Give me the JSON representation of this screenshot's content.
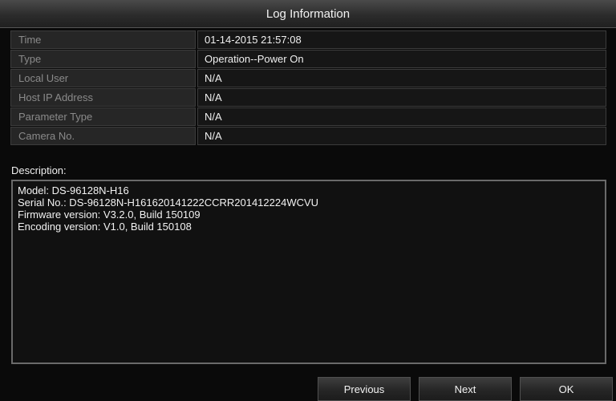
{
  "window": {
    "title": "Log Information"
  },
  "fields": [
    {
      "label": "Time",
      "value": "01-14-2015 21:57:08"
    },
    {
      "label": "Type",
      "value": "Operation--Power On"
    },
    {
      "label": "Local User",
      "value": "N/A"
    },
    {
      "label": "Host IP Address",
      "value": "N/A"
    },
    {
      "label": "Parameter Type",
      "value": "N/A"
    },
    {
      "label": "Camera No.",
      "value": "N/A"
    }
  ],
  "description": {
    "label": "Description:",
    "lines": [
      "Model: DS-96128N-H16",
      "Serial No.: DS-96128N-H161620141222CCRR201412224WCVU",
      "Firmware version: V3.2.0, Build 150109",
      "Encoding version: V1.0, Build 150108"
    ]
  },
  "buttons": {
    "previous": "Previous",
    "next": "Next",
    "ok": "OK"
  },
  "colors": {
    "background": "#0a0a0a",
    "label_cell": "#262626",
    "value_cell": "#161616",
    "label_text": "#8a8a8a",
    "value_text": "#f0f0f0"
  }
}
